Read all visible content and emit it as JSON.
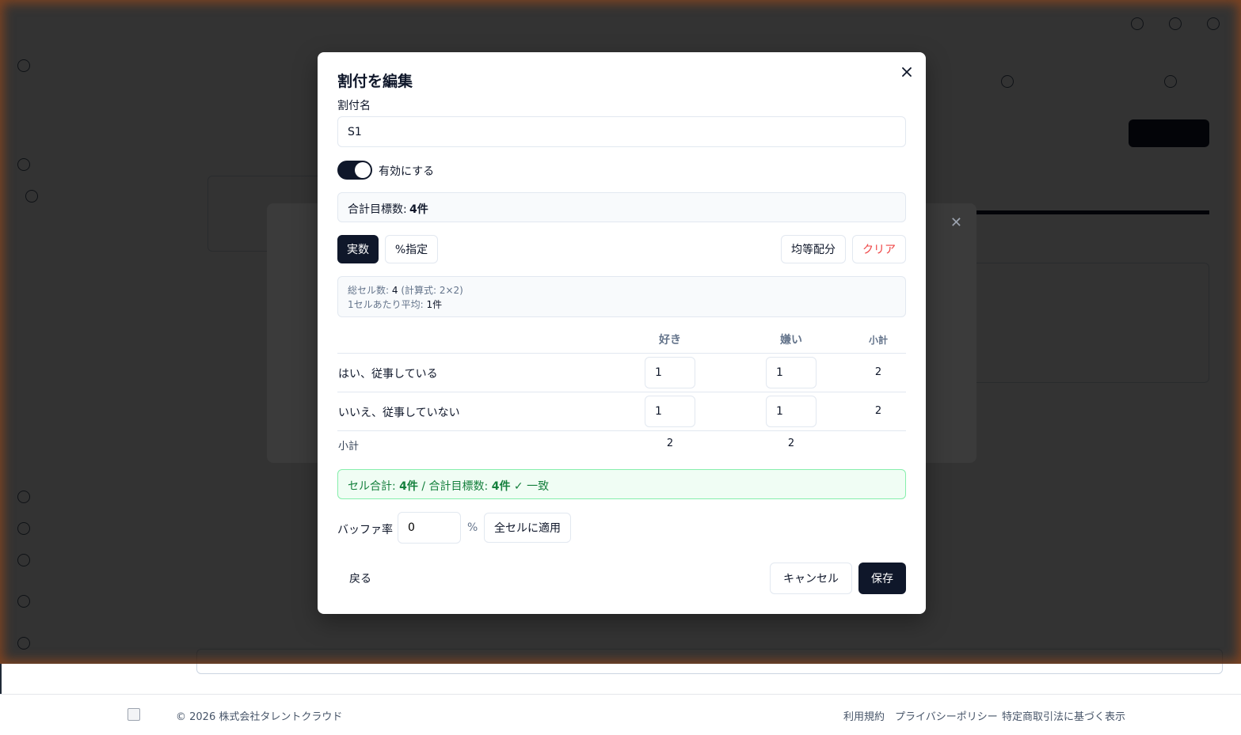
{
  "footer": {
    "copyright": "© 2026 株式会社タレントクラウド",
    "links": [
      "利用規約",
      "プライバシーポリシー",
      "特定商取引法に基づく表示"
    ]
  },
  "modal": {
    "title": "割付を編集",
    "name_label": "割付名",
    "name_value": "S1",
    "toggle_label": "有効にする",
    "toggle_on": true,
    "target_prefix": "合計目標数: ",
    "target_value": "4件",
    "mode_buttons": [
      "実数",
      "%指定"
    ],
    "active_mode": "実数",
    "equal_button": "均等配分",
    "clear_button": "クリア",
    "info": {
      "total_cells_label": "総セル数: ",
      "total_cells_value": "4",
      "formula": " (計算式: 2×2)",
      "avg_label": "1セルあたり平均: ",
      "avg_value": "1件"
    },
    "table": {
      "columns": [
        "好き",
        "嫌い"
      ],
      "subtotal_header": "小計",
      "rows": [
        {
          "label": "はい、従事している",
          "values": [
            "1",
            "1"
          ],
          "subtotal": "2"
        },
        {
          "label": "いいえ、従事していない",
          "values": [
            "1",
            "1"
          ],
          "subtotal": "2"
        }
      ],
      "subtotal_label": "小計",
      "column_subtotals": [
        "2",
        "2"
      ]
    },
    "status": {
      "cell_sum_label": "セル合計: ",
      "cell_sum_value": "4件",
      "separator": " / ",
      "target_label": "合計目標数: ",
      "target_value": "4件",
      "match_text": " ✓ 一致"
    },
    "buffer": {
      "label": "バッファ率",
      "value": "0",
      "unit": "%",
      "apply_button": "全セルに適用"
    },
    "back_button": "戻る",
    "cancel_button": "キャンセル",
    "save_button": "保存",
    "colors": {
      "primary": "#0f172a",
      "danger": "#ef4444",
      "success": "#15803d",
      "success_bg": "#f0fdf4"
    }
  }
}
